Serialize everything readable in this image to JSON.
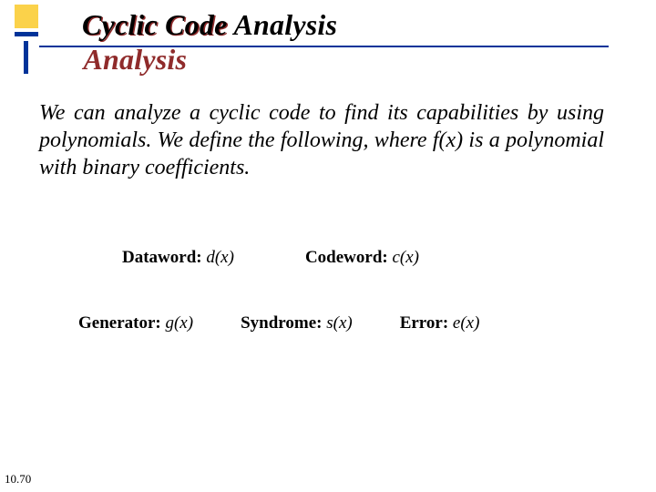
{
  "title": "Cyclic Code Analysis",
  "paragraph": "We can analyze a cyclic code to find its capabilities by using polynomials. We define the following, where f(x) is a polynomial with binary coefficients.",
  "defs": {
    "dataword_label": "Dataword:",
    "dataword_sym": "d(x)",
    "codeword_label": "Codeword:",
    "codeword_sym": "c(x)",
    "generator_label": "Generator:",
    "generator_sym": "g(x)",
    "syndrome_label": "Syndrome:",
    "syndrome_sym": "s(x)",
    "error_label": "Error:",
    "error_sym": "e(x)"
  },
  "page_number": "10.70"
}
